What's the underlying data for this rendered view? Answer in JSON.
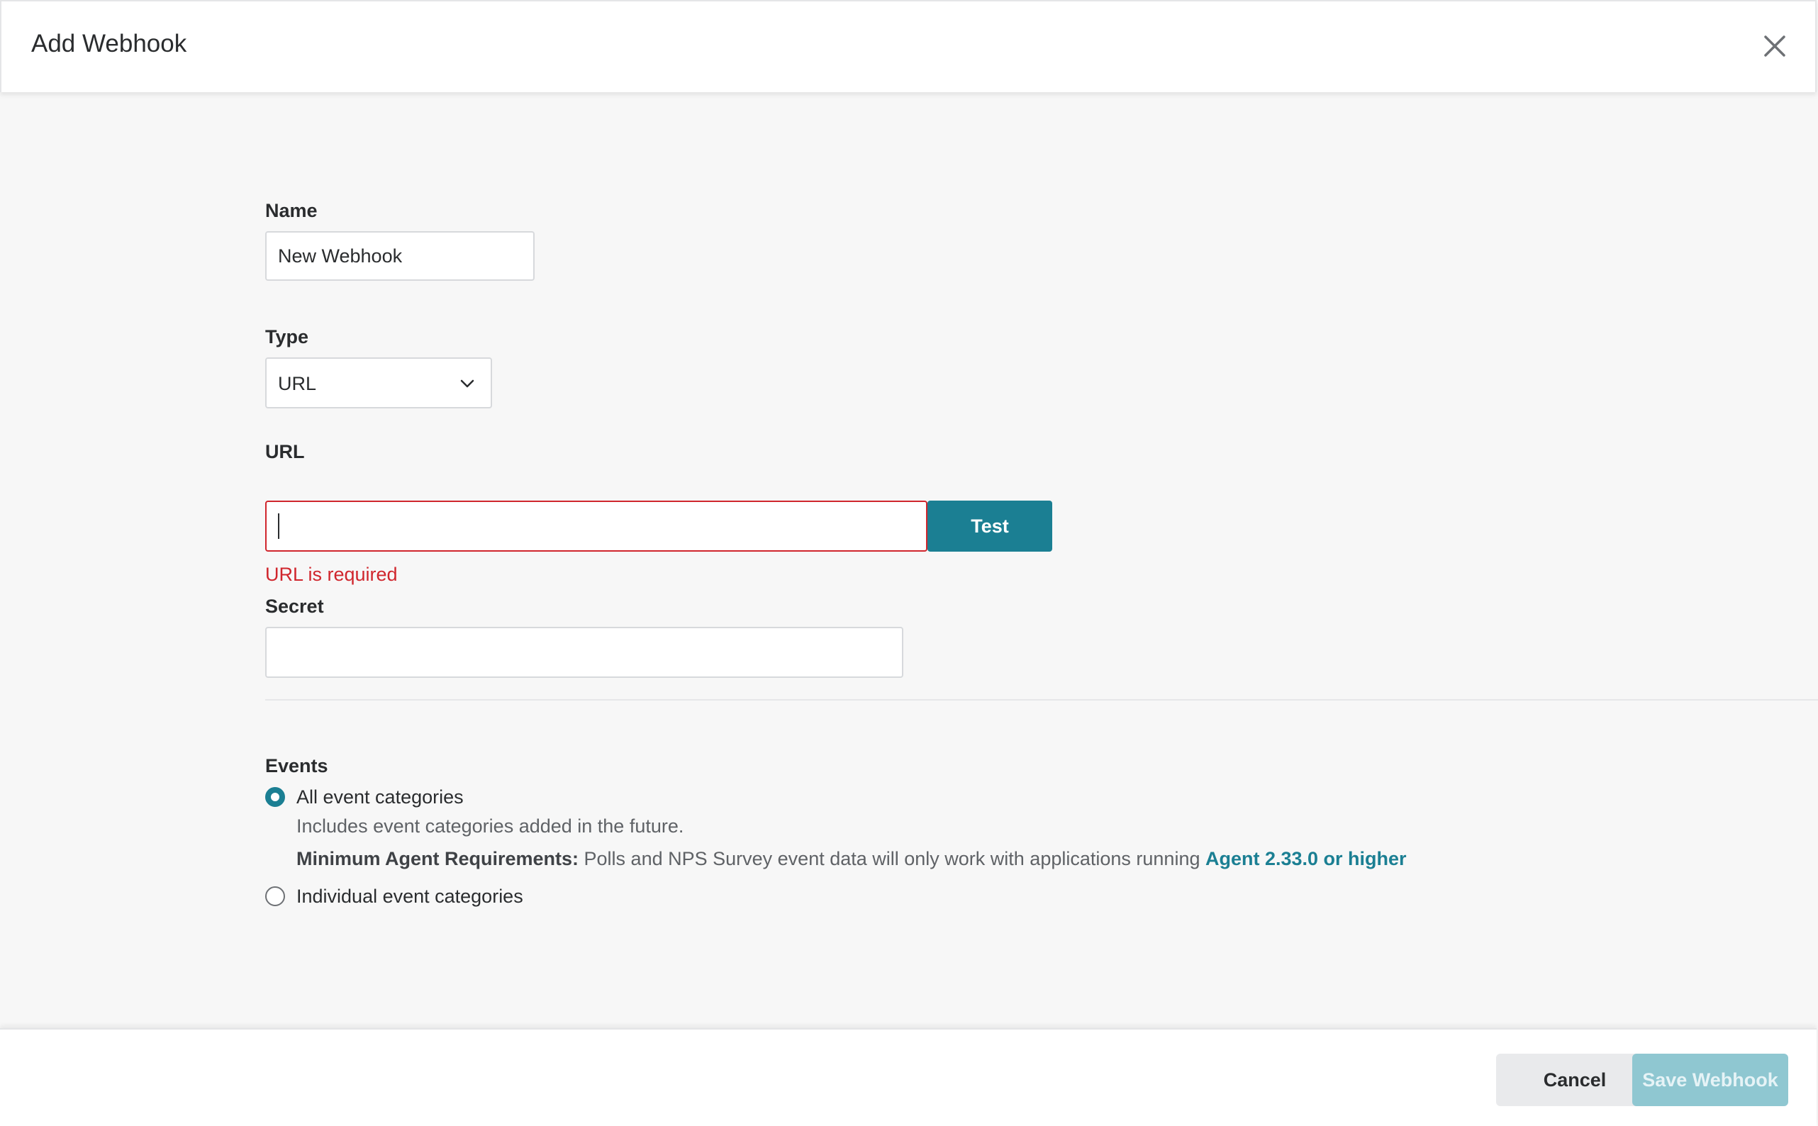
{
  "dialog": {
    "title": "Add Webhook",
    "close_icon": "close-icon"
  },
  "form": {
    "name": {
      "label": "Name",
      "value": "New Webhook"
    },
    "type": {
      "label": "Type",
      "selected": "URL",
      "chevron_icon": "chevron-down-icon"
    },
    "url": {
      "label": "URL",
      "value": "",
      "error": "URL is required",
      "test_label": "Test"
    },
    "secret": {
      "label": "Secret",
      "value": ""
    },
    "events": {
      "label": "Events",
      "options": [
        {
          "label": "All event categories",
          "selected": true,
          "description": "Includes event categories added in the future.",
          "requirement_prefix": "Minimum Agent Requirements:",
          "requirement_text": " Polls and NPS Survey event data will only work with applications running ",
          "requirement_link": "Agent 2.33.0 or higher"
        },
        {
          "label": "Individual event categories",
          "selected": false
        }
      ]
    }
  },
  "footer": {
    "cancel_label": "Cancel",
    "save_label": "Save Webhook"
  },
  "colors": {
    "accent": "#1b7f93",
    "error": "#d0262d",
    "save_disabled": "#8fc7d1"
  }
}
